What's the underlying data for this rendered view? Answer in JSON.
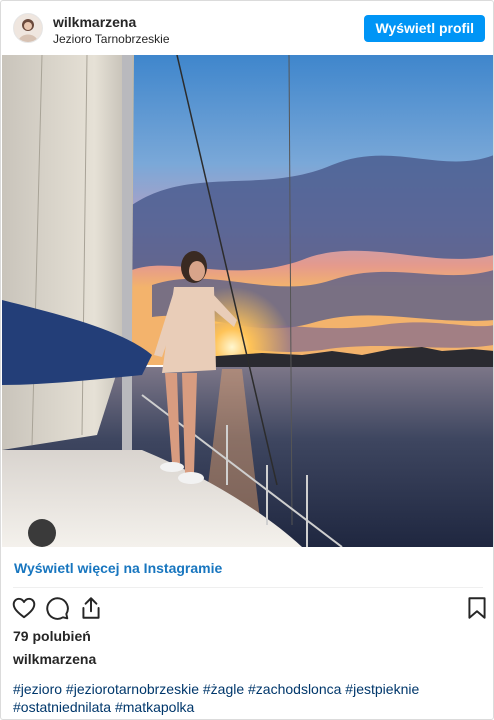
{
  "header": {
    "username": "wilkmarzena",
    "location": "Jezioro Tarnobrzeskie",
    "profile_button": "Wyświetl profil"
  },
  "post": {
    "view_more_link": "Wyświetl więcej na Instagramie",
    "likes": "79 polubień",
    "caption_username": "wilkmarzena",
    "hashtags": "#jezioro #jeziorotarnobrzeskie #żagle #zachodslonca #jestpieknie #ostatniednilata #matkapolka"
  },
  "actions": {
    "like_icon": "heart-icon",
    "comment_icon": "comment-icon",
    "share_icon": "share-icon",
    "save_icon": "bookmark-icon"
  },
  "colors": {
    "accent": "#0095f6",
    "link": "#1876bf",
    "hashtag": "#00376b"
  }
}
